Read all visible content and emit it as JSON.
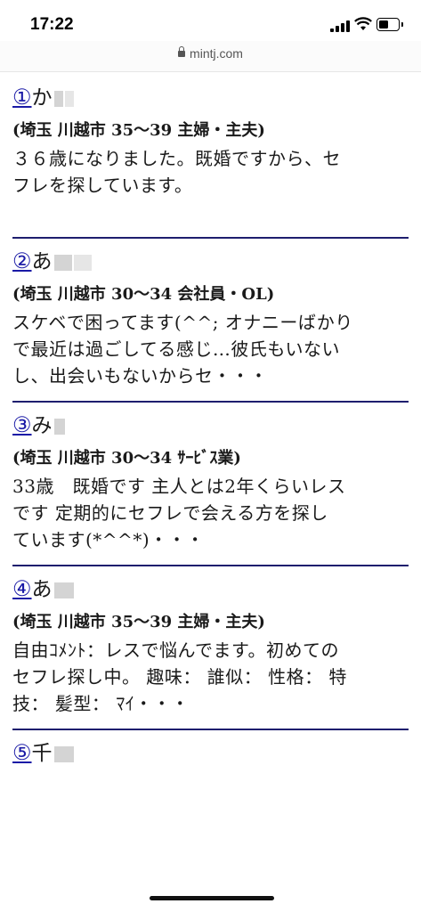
{
  "status": {
    "time": "17:22"
  },
  "browser": {
    "url": "mintj.com"
  },
  "entries": [
    {
      "num": "①",
      "name": "か",
      "meta": "(埼玉 川越市 35〜39 主婦・主夫)",
      "lines": [
        "３６歳になりました。既婚ですから、セ",
        "フレを探しています。"
      ]
    },
    {
      "num": "②",
      "name": "あ",
      "meta": "(埼玉 川越市 30〜34 会社員・OL)",
      "lines": [
        "スケベで困ってます(^^; オナニーばかり",
        "で最近は過ごしてる感じ…彼氏もいない",
        "し、出会いもないからセ・・・"
      ]
    },
    {
      "num": "③",
      "name": "み",
      "meta": "(埼玉 川越市 30〜34 ｻｰﾋﾞｽ業)",
      "lines": [
        "33歳　既婚です 主人とは2年くらいレス",
        "です 定期的にセフレで会える方を探し",
        "ています(*^^*)・・・"
      ]
    },
    {
      "num": "④",
      "name": "あ",
      "meta": "(埼玉 川越市 35〜39 主婦・主夫)",
      "lines": [
        "自由ｺﾒﾝﾄ：レスで悩んでます。初めての",
        "セフレ探し中。 趣味： 誰似： 性格： 特",
        "技： 髪型： ﾏｲ・・・"
      ]
    },
    {
      "num": "⑤",
      "name": "千"
    }
  ]
}
